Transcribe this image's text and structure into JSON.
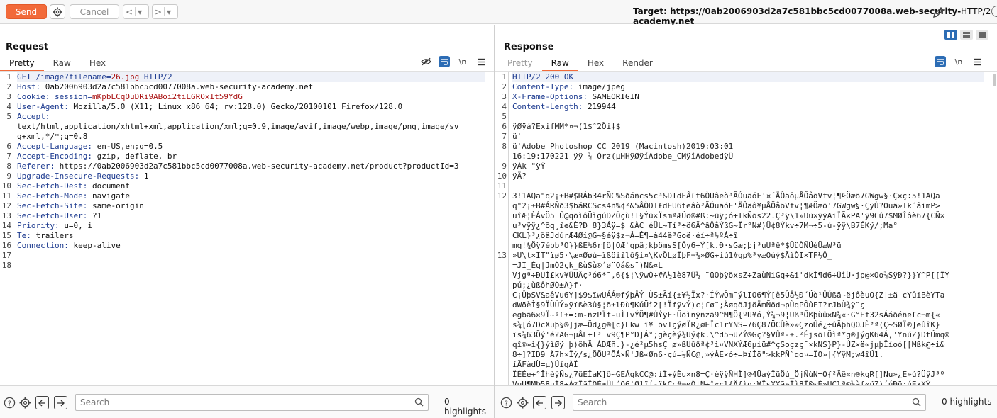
{
  "toolbar": {
    "send": "Send",
    "cancel": "Cancel",
    "back": "<",
    "back_menu": "▾",
    "forward": ">",
    "forward_menu": "▾",
    "target": "Target: https://0ab2006903d2a7c581bbc5cd0077008a.web-security-academy.net",
    "http_version": "HTTP/2"
  },
  "request": {
    "title": "Request",
    "tabs": [
      "Pretty",
      "Raw",
      "Hex"
    ],
    "newline_toggle": "\\n",
    "lines": [
      {
        "n": "1",
        "k": "GET /image?filename=",
        "v": "26.jpg",
        "rest": " HTTP/2"
      },
      {
        "n": "2",
        "k": "Host: ",
        "v": "0ab2006903d2a7c581bbc5cd0077008a.web-security-academy.net"
      },
      {
        "n": "3",
        "k": "Cookie: session=",
        "v": "mKpbLCqOuDRi9ABoi2tiLGROxIt59YdG"
      },
      {
        "n": "4",
        "k": "User-Agent: ",
        "v": "Mozilla/5.0 (X11; Linux x86_64; rv:128.0) Gecko/20100101 Firefox/128.0"
      },
      {
        "n": "5",
        "k": "Accept:",
        "v": ""
      },
      {
        "n": "",
        "k": "",
        "v": "text/html,application/xhtml+xml,application/xml;q=0.9,image/avif,image/webp,image/png,image/sv"
      },
      {
        "n": "",
        "k": "",
        "v": "g+xml,*/*;q=0.8"
      },
      {
        "n": "6",
        "k": "Accept-Language: ",
        "v": "en-US,en;q=0.5"
      },
      {
        "n": "7",
        "k": "Accept-Encoding: ",
        "v": "gzip, deflate, br"
      },
      {
        "n": "8",
        "k": "Referer: ",
        "v": "https://0ab2006903d2a7c581bbc5cd0077008a.web-security-academy.net/product?productId=3"
      },
      {
        "n": "9",
        "k": "Upgrade-Insecure-Requests: ",
        "v": "1"
      },
      {
        "n": "10",
        "k": "Sec-Fetch-Dest: ",
        "v": "document"
      },
      {
        "n": "11",
        "k": "Sec-Fetch-Mode: ",
        "v": "navigate"
      },
      {
        "n": "12",
        "k": "Sec-Fetch-Site: ",
        "v": "same-origin"
      },
      {
        "n": "13",
        "k": "Sec-Fetch-User: ",
        "v": "?1"
      },
      {
        "n": "14",
        "k": "Priority: ",
        "v": "u=0, i"
      },
      {
        "n": "15",
        "k": "Te: ",
        "v": "trailers"
      },
      {
        "n": "16",
        "k": "Connection: ",
        "v": "keep-alive"
      },
      {
        "n": "17",
        "k": "",
        "v": ""
      },
      {
        "n": "18",
        "k": "",
        "v": ""
      }
    ],
    "search_placeholder": "Search",
    "highlights": "0 highlights"
  },
  "response": {
    "title": "Response",
    "tabs": [
      "Pretty",
      "Raw",
      "Hex",
      "Render"
    ],
    "newline_toggle": "\\n",
    "lines": [
      {
        "n": "1",
        "k": "HTTP/2 200 OK",
        "v": ""
      },
      {
        "n": "2",
        "k": "Content-Type: ",
        "v": "image/jpeg"
      },
      {
        "n": "3",
        "k": "X-Frame-Options: ",
        "v": "SAMEORIGIN"
      },
      {
        "n": "4",
        "k": "Content-Length: ",
        "v": "219944"
      },
      {
        "n": "5",
        "k": "",
        "v": ""
      },
      {
        "n": "6",
        "k": "",
        "v": "ÿØÿá?ExifMM*¤¬(1$ˆ2Öi‡$"
      },
      {
        "n": "7",
        "k": "",
        "v": "ü'"
      },
      {
        "n": "8",
        "k": "",
        "v": "ü'Adobe Photoshop CC 2019 (Macintosh)2019:03:01"
      },
      {
        "n": "",
        "k": "",
        "v": "16:19:170221 ÿÿ ¾ Órz(µHHÿØÿíAdobe_CMÿîAdobedÿÛ"
      },
      {
        "n": "9",
        "k": "",
        "v": "ÿÀk \"ÿÝ"
      },
      {
        "n": "10",
        "k": "",
        "v": "ÿÄ?"
      },
      {
        "n": "11",
        "k": "",
        "v": ""
      },
      {
        "n": "12",
        "k": "",
        "v": "3!1AQa\"q2¡±B#$RÁb34rÑC%Sðáñcs5¢³&DTdEÂ£t6ÒUâeò³ÃÓuãóF'¤´ÄÔäôµÅÕåõVfv¦¶ÆÖæö7GWgw§·Ç×ç÷5!1AQa"
      },
      {
        "n": "",
        "k": "",
        "v": "q\"2¡±B#ÁRÑð3$báRCScs4ñ%¢²&5ÂÒDT£dEU6teâò³ÃÓuãóF'ÄÔäô¥µÅÕåõVfv¦¶ÆÖæö'7GWgw§·ÇÿÙ?Ouä»Ik´âimP>"
      },
      {
        "n": "",
        "k": "",
        "v": "uîÆ¦ÈÁvÖ5¯Û@qõìôÜìgúDZÖçù!I§Ýü×ÏsmªÆÜö®#ß:~üÿ;ó+IkÑõs22.Ç³ÿ\\1»Uü×ÿÿAiÏÃ×PA'ÿ9Cû7$MØÎôè67{CÑ×"
      },
      {
        "n": "",
        "k": "",
        "v": "u³vÿÿ¿^õq¸îe&È?Ð 8}3Áÿ=$ &ÀC éÜL~Tí³÷ö6Ã^âÔåÝßG~Ïr°N#)Ü¢8Ýkv÷7M¬÷5-ú-ÿÿ\\B7ÉKÿ/;Ma°"
      },
      {
        "n": "",
        "k": "",
        "v": "CKL}³¿öâJdúrÆ4Øí@G~§éÿ$z¬Â=É¶=à44ë³Goë·éí÷ª½ºÁ÷î"
      },
      {
        "n": "",
        "k": "",
        "v": "mq!¾Öÿ7éþb³O}}ßE%6r[ö|OÆ`qpä;kþömsS[Óy6÷Ý[k.Ð·sGæ;þj³uUªê*$ÛüÒÑÜèÜæW³ü"
      },
      {
        "n": "13",
        "k": "",
        "v": "»U\\t×IT\"ïø5·\\æ¤Øøú~ïßöiîlô§i¤\\KvÖLøÏþF¬¼»ØG÷iú1#qp%³yæOúý$ÃìÒI×TF½Ô_"
      },
      {
        "n": "",
        "k": "",
        "v": "=JI_Éq|JmÓ2çk_ßùSù®´ø¨Öá&s¯)N&¤L"
      },
      {
        "n": "",
        "k": "",
        "v": "Vjgª÷ÐÜÍ£kv¥ÛÜÂç³ó6*¯,6{$¦\\ÿwÓ÷#Ã½1è87Û½ ¨üÖþÿöxsZ÷ZaùNiGq÷&i'dkÌ¶d6÷ÛîÛ·jp@×Oo¾SÿÐ?}}Y^P[[ÎÝ"
      },
      {
        "n": "",
        "k": "",
        "v": "pú;¿ùßôhØÓ±Ã}f·"
      },
      {
        "n": "",
        "k": "",
        "v": "C¡ÛþSV&aêVu6Y]$9$ïwUÁÁ®fýþÂÝ ÙS±Ãí{±¥½Ïx?·ÍÝwÔm¯ýlIO6¶Ý[ê5Ûå½Ð´Üò¹ÛÚßä~ëjôèuO{Z|±ä cYûïBèYTa"
      },
      {
        "n": "",
        "k": "",
        "v": "dWöèÌ§9ÏÜÜÝ»ÿïßè3û§¦õ±lÐù¶KúÜî2[!ÏfÿvÝ)c¦£ø¨;ÄøqðJjöÄmÑðd¬pÙqPÔûFI?rJbÙ¾ÿ¨ç"
      },
      {
        "n": "",
        "k": "",
        "v": "egbä6×9Ï~ª£±=÷m-ñzPÏf-uÌIvÝÖ¶#ÚÝÿF·Üöìnÿñzä9^M¶Õ{ºU¥ó,Ý¾¬9¦Uß³Õßþùû×N¾«·G°Ef32sÁáðéñe£c¬m{«"
      },
      {
        "n": "",
        "k": "",
        "v": "s¾[ó7DcXµþ§®]jæ=Õd¿g®[c}Lkw¯ï¥¨õvTçýøÏR¿øEÏc1rYNS=76Ç87ÖCÛè»»ÇzoÛé¿÷ûÃþhQOJÈ³ª(Ç~SØÏ®]eûîK}"
      },
      {
        "n": "",
        "k": "",
        "v": "ïs¾63Õý'é?AG¬µÂL+l³_v9Ç¶P°D]Á°;gèçèý¾Uý¢k.\\^d5¬üZÝ®Gç?§VÛª-±.²ÉjsölÖìª*g®]ýgK64Á,'YnúZ}DtÜmq®"
      },
      {
        "n": "",
        "k": "",
        "v": "qî®»ì{}ýìØÿ_þ)öhÃ_ÁDÆñ.}-¿é²µ5hsÇ ø»ßUûðª¢³ì¤VNXÝÆ6µiü#^çSoçzç¯×kNS}P}-ÚZ×ë«jµþÏíoó[[Mßk@÷i&"
      },
      {
        "n": "",
        "k": "",
        "v": "8÷]?ID9 Ä7h×Ïý/s¿ÕÕU²ÕÁ×Ñ'Jß«Øn6·çú=½ÑC@,»ýÂE×ó÷=ÞïÎö\">kkPÑ`qo¤=ÏO»|{YÿM;w4îÜ1."
      },
      {
        "n": "",
        "k": "",
        "v": "íÃFàdÜ=µ)ÚígÀÏ"
      },
      {
        "n": "",
        "k": "",
        "v": "ÏÈÉe+°ÎhèÿÑs¿7üEÎaK]ô~GEÁqkCC@:íÏ÷ýÈu×n8=Ç·èÿÿÑHÌ]®4ÜaýÏüÖú_ÖjÑùN=O{²Ãë«n®kgR[]Nu»¿E»ú?ÜÿJ³º"
      },
      {
        "n": "",
        "k": "",
        "v": "VuÜ¶MÞ58uÍ8+À®ÏãÎÕÈ±ÛL´Ö6'Ø]ïí-ïkCc#¬øÕ|Ñ+î«cl{Â{ìq:¥ÏsXXã»Ïì8ÏßwÈ»ÜÇlª®¼àf«üZ)´úÐü:úExXÝ"
      }
    ],
    "search_placeholder": "Search",
    "highlights": "0 highlights"
  },
  "colors": {
    "accent": "#f26a3a",
    "toggle_blue": "#2d6db5",
    "header_key": "#1c3a8f",
    "header_value_highlight": "#a11111"
  }
}
